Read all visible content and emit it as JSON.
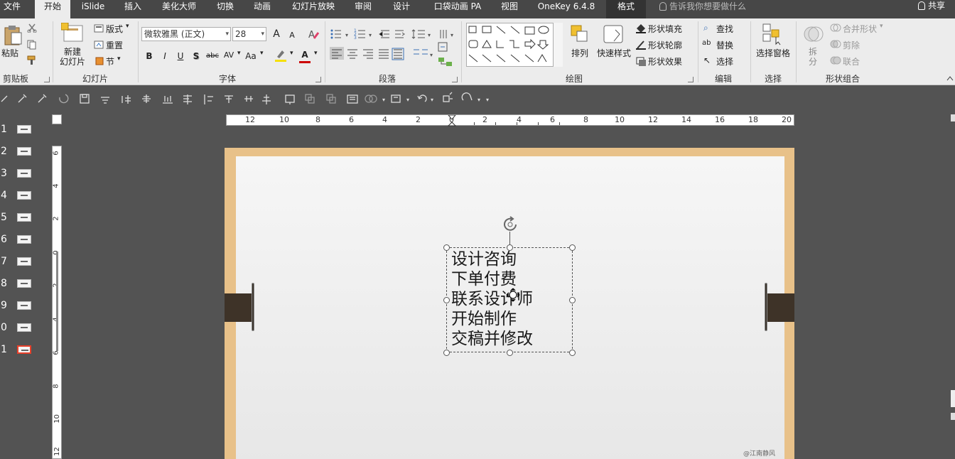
{
  "tabs": [
    "文件",
    "开始",
    "iSlide",
    "插入",
    "美化大师",
    "切换",
    "动画",
    "幻灯片放映",
    "审阅",
    "设计",
    "口袋动画 PA",
    "视图",
    "OneKey 6.4.8",
    "格式"
  ],
  "active_tab": "开始",
  "tell_me": "告诉我你想要做什么",
  "share": "共享",
  "ribbon": {
    "clipboard": {
      "label": "剪贴板",
      "paste": "粘贴"
    },
    "slides": {
      "label": "幻灯片",
      "new_slide": "新建\n幻灯片",
      "layout": "版式",
      "reset": "重置",
      "section": "节"
    },
    "font": {
      "label": "字体",
      "font_name": "微软雅黑 (正文)",
      "font_size": "28"
    },
    "paragraph": {
      "label": "段落"
    },
    "drawing": {
      "label": "绘图",
      "arrange": "排列",
      "quick_styles": "快速样式",
      "shape_fill": "形状填充",
      "shape_outline": "形状轮廓",
      "shape_effects": "形状效果"
    },
    "editing": {
      "label": "编辑",
      "find": "查找",
      "replace": "替换",
      "select": "选择"
    },
    "selection": {
      "label": "选择",
      "selection_pane": "选择窗格"
    },
    "shape_combine": {
      "label": "形状组合",
      "split": "拆\n分",
      "merge": "合并形状",
      "cut": "剪除",
      "union": "联合"
    }
  },
  "ribbon_glyphs": {
    "font_grow": "A",
    "font_shrink": "A",
    "bold": "B",
    "italic": "I",
    "underline": "U",
    "shadow": "S",
    "strikethrough": "abc",
    "spacing": "AV",
    "change_case": "Aa",
    "font_color": "A",
    "find_icon": "⌕",
    "replace_icon": "ab",
    "select_icon": "↖"
  },
  "slides": [
    "1",
    "2",
    "3",
    "4",
    "5",
    "6",
    "7",
    "8",
    "9",
    "0",
    "1"
  ],
  "selected_slide_index": 10,
  "hruler_labels": [
    "12",
    "10",
    "8",
    "6",
    "4",
    "2",
    "0",
    "2",
    "4",
    "6",
    "8",
    "10",
    "12",
    "14",
    "16",
    "18",
    "20"
  ],
  "vruler_labels": [
    "6",
    "4",
    "2",
    "0",
    "2",
    "4",
    "6",
    "8",
    "10",
    "12"
  ],
  "textbox": {
    "lines": [
      "设计咨询",
      "下单付费",
      "联系设计师",
      "开始制作",
      "交稿并修改"
    ]
  },
  "watermark": "@江南静风",
  "colors": {
    "tabbar": "#474747",
    "ribbon": "#ececec",
    "workspace": "#535353",
    "wood": "#e8c189",
    "slide_bg": "#f2f2f2",
    "selected_thumb": "#e8402a"
  }
}
